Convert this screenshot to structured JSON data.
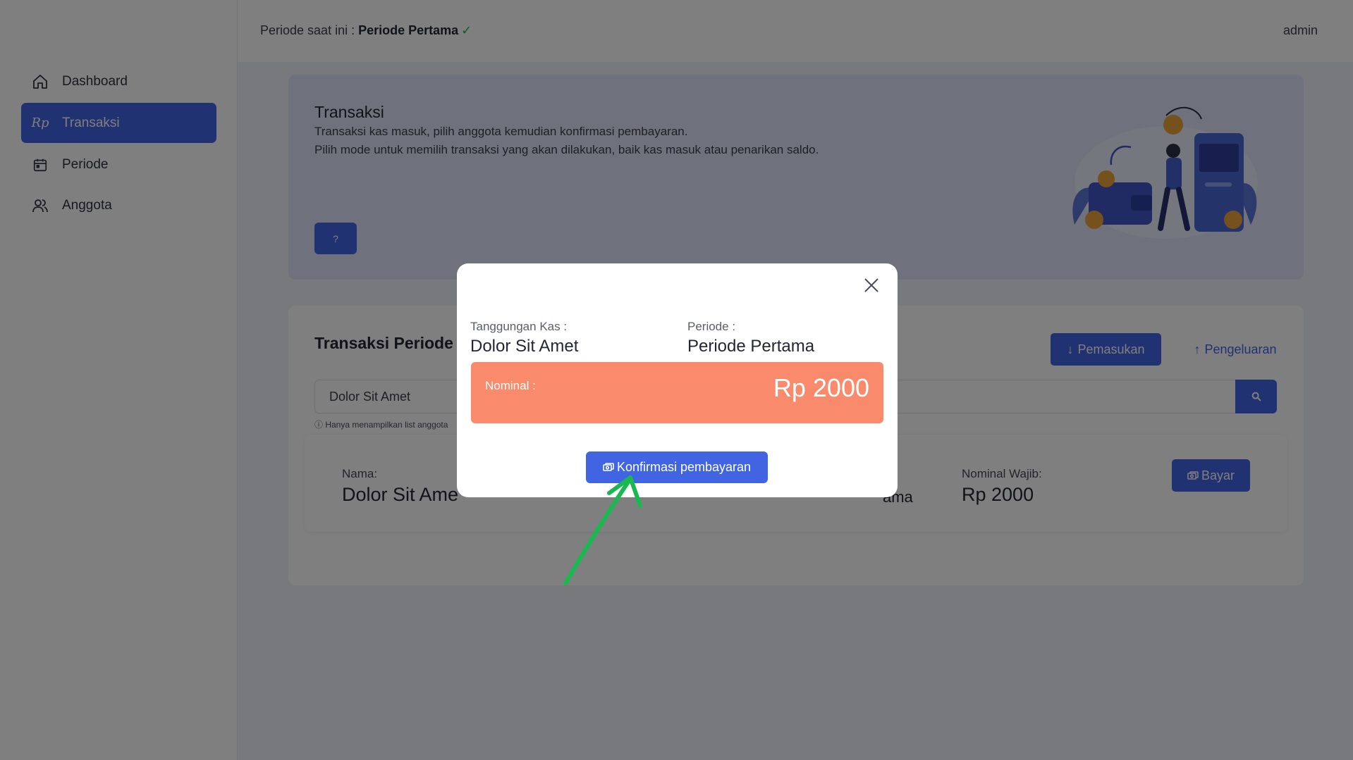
{
  "sidebar": {
    "items": [
      {
        "label": "Dashboard",
        "icon": "home-icon"
      },
      {
        "label": "Transaksi",
        "icon": "rupiah-icon",
        "glyph": "Rp"
      },
      {
        "label": "Periode",
        "icon": "calendar-icon"
      },
      {
        "label": "Anggota",
        "icon": "users-icon"
      }
    ]
  },
  "topbar": {
    "period_prefix": "Periode saat ini : ",
    "period_name": "Periode Pertama",
    "period_check": "✓",
    "user": "admin"
  },
  "hero": {
    "title": "Transaksi",
    "desc_line1": "Transaksi kas masuk, pilih anggota kemudian konfirmasi pembayaran.",
    "desc_line2": "Pilih mode untuk memilih transaksi yang akan dilakukan, baik kas masuk atau penarikan saldo.",
    "help_label": "?"
  },
  "card": {
    "title": "Transaksi Periode P",
    "pemasukan_label": "Pemasukan",
    "pengeluaran_label": "Pengeluaran",
    "search_value": "Dolor Sit Amet",
    "hint": "Hanya menampilkan list anggota",
    "member": {
      "name_label": "Nama:",
      "name_value": "Dolor Sit Ame",
      "period_value_partial": "ama",
      "nominal_label": "Nominal Wajib:",
      "nominal_value": "Rp 2000",
      "pay_label": "Bayar"
    }
  },
  "modal": {
    "tanggungan_label": "Tanggungan Kas :",
    "tanggungan_value": "Dolor Sit Amet",
    "periode_label": "Periode :",
    "periode_value": "Periode Pertama",
    "nominal_label": "Nominal :",
    "nominal_value": "Rp 2000",
    "confirm_label": "Konfirmasi pembayaran"
  },
  "colors": {
    "primary": "#4164e3",
    "nominal_bg": "#f98a6b",
    "annotation_arrow": "#19b94f"
  }
}
